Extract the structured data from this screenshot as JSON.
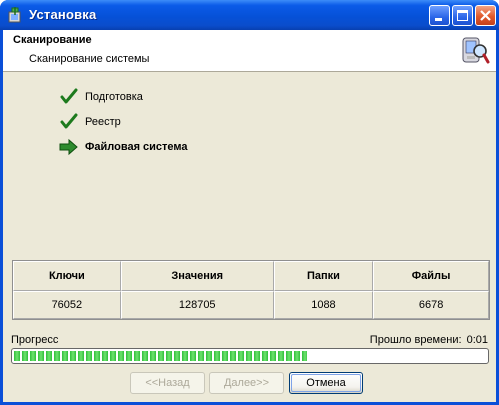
{
  "window": {
    "title": "Установка",
    "app_icon": "installer-icon",
    "controls": [
      "minimize-icon",
      "maximize-icon",
      "close-icon"
    ]
  },
  "header": {
    "title": "Сканирование",
    "subtitle": "Сканирование системы",
    "icon": "pda-magnifier-icon"
  },
  "steps": [
    {
      "label": "Подготовка",
      "status": "done",
      "icon": "checkmark-icon"
    },
    {
      "label": "Реестр",
      "status": "done",
      "icon": "checkmark-icon"
    },
    {
      "label": "Файловая система",
      "status": "current",
      "icon": "arrow-right-icon"
    }
  ],
  "stats": {
    "headers": [
      "Ключи",
      "Значения",
      "Папки",
      "Файлы"
    ],
    "values": [
      "76052",
      "128705",
      "1088",
      "6678"
    ]
  },
  "progress": {
    "label": "Прогресс",
    "elapsed_label": "Прошло времени:",
    "elapsed_value": "0:01",
    "fraction": 0.62
  },
  "buttons": {
    "back": "<<Назад",
    "next": "Далее>>",
    "cancel": "Отмена"
  },
  "colors": {
    "titlebar": "#0651d8",
    "client_bg": "#ece9d8",
    "check": "#2e8b2e",
    "progress": "#2fbf3a"
  }
}
